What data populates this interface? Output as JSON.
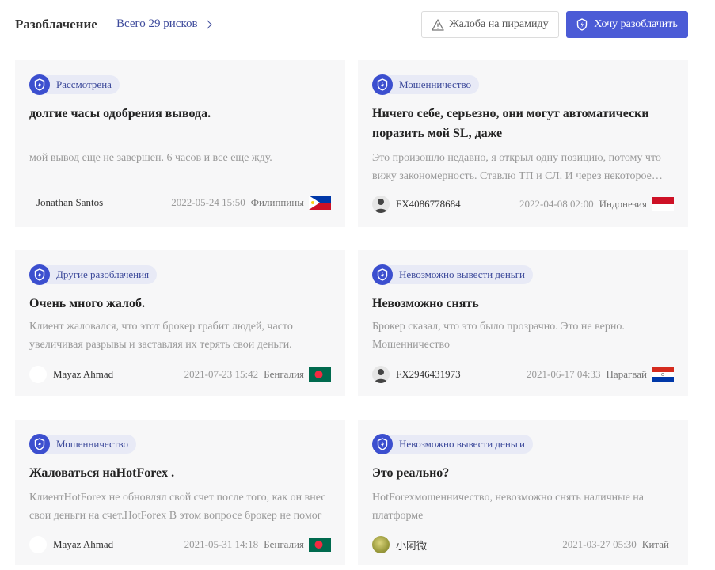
{
  "header": {
    "title": "Разоблачение",
    "total_link": "Всего 29 рисков",
    "complaint_button": "Жалоба на пирамиду",
    "expose_button": "Хочу разоблачить"
  },
  "cards": [
    {
      "category": "Рассмотрена",
      "title": "долгие часы одобрения вывода.",
      "description": "мой вывод еще не завершен. 6 часов и все еще жду.",
      "author": "Jonathan Santos",
      "date": "2022-05-24 15:50",
      "country": "Филиппины",
      "flag_icon": "philippines-flag-icon"
    },
    {
      "category": "Мошенничество",
      "title": "Ничего себе, серьезно, они могут автоматически поразить мой SL, даже",
      "description": "Это произошло недавно, я открыл одну позицию, потому что вижу закономерность. Ставлю ТП и СЛ. И через некоторое время",
      "author": "FX4086778684",
      "date": "2022-04-08 02:00",
      "country": "Индонезия",
      "flag_icon": "indonesia-flag-icon"
    },
    {
      "category": "Другие разоблачения",
      "title": "Очень много жалоб.",
      "description": "Клиент жаловался, что этот брокер грабит людей, часто увеличивая разрывы и заставляя их терять свои деньги.",
      "author": "Mayaz Ahmad",
      "date": "2021-07-23 15:42",
      "country": "Бенгалия",
      "flag_icon": "bangladesh-flag-icon"
    },
    {
      "category": "Невозможно вывести деньги",
      "title": "Невозможно снять",
      "description": "Брокер сказал, что это было прозрачно. Это не верно. Мошенничество",
      "author": "FX2946431973",
      "date": "2021-06-17 04:33",
      "country": "Парагвай",
      "flag_icon": "paraguay-flag-icon"
    },
    {
      "category": "Мошенничество",
      "title": "Жаловаться наHotForex .",
      "description": "КлиентHotForex не обновлял свой счет после того, как он внес свои деньги на счет.HotForex В этом вопросе брокер не помог",
      "author": "Mayaz Ahmad",
      "date": "2021-05-31 14:18",
      "country": "Бенгалия",
      "flag_icon": "bangladesh-flag-icon"
    },
    {
      "category": "Невозможно вывести деньги",
      "title": "Это реально?",
      "description": "HotForexмошенничество, невозможно снять наличные на платформе",
      "author": "小阿微",
      "date": "2021-03-27 05:30",
      "country": "Китай",
      "flag_icon": ""
    }
  ],
  "colors": {
    "accent": "#4b5bd6",
    "badge_bg": "#e8eaf6",
    "card_bg": "#f7f7f8"
  }
}
